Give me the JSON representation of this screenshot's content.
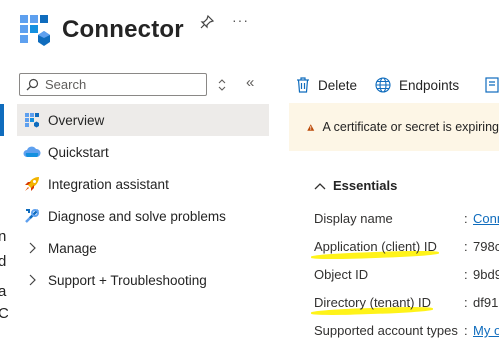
{
  "left_edge_fragments": [
    "n",
    "d",
    "a",
    "C"
  ],
  "header": {
    "title": "Connector",
    "more_label": "···"
  },
  "search": {
    "placeholder": "Search"
  },
  "collapse_label": "«",
  "sidebar": {
    "items": [
      {
        "label": "Overview",
        "icon": "overview-grid-icon",
        "active": true
      },
      {
        "label": "Quickstart",
        "icon": "cloud-icon"
      },
      {
        "label": "Integration assistant",
        "icon": "rocket-icon"
      },
      {
        "label": "Diagnose and solve problems",
        "icon": "wrench-icon"
      },
      {
        "label": "Manage",
        "icon": "chevron-right-icon",
        "expandable": true
      },
      {
        "label": "Support + Troubleshooting",
        "icon": "chevron-right-icon",
        "expandable": true
      }
    ]
  },
  "toolbar": {
    "delete_label": "Delete",
    "endpoints_label": "Endpoints"
  },
  "banner": {
    "text": "A certificate or secret is expiring"
  },
  "essentials": {
    "title": "Essentials",
    "rows": [
      {
        "label": "Display name",
        "value": "Conn"
      },
      {
        "label": "Application (client) ID",
        "value": "798c"
      },
      {
        "label": "Object ID",
        "value": "9bd9"
      },
      {
        "label": "Directory (tenant) ID",
        "value": "df91"
      },
      {
        "label": "Supported account types",
        "value": "My o"
      }
    ]
  },
  "colors": {
    "accent": "#0f6cbd",
    "warning": "#bc4b09",
    "banner_bg": "#fdf6e6",
    "highlight": "#fff200"
  }
}
